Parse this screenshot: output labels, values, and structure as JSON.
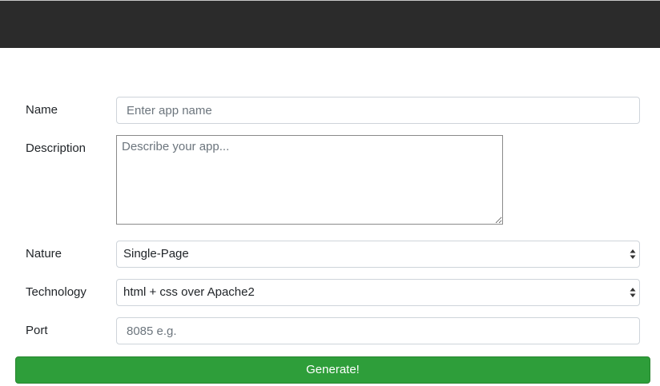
{
  "form": {
    "name": {
      "label": "Name",
      "placeholder": "Enter app name",
      "value": ""
    },
    "description": {
      "label": "Description",
      "placeholder": "Describe your app...",
      "value": ""
    },
    "nature": {
      "label": "Nature",
      "selected": "Single-Page"
    },
    "technology": {
      "label": "Technology",
      "selected": "html + css over Apache2"
    },
    "port": {
      "label": "Port",
      "placeholder": "8085 e.g.",
      "value": ""
    },
    "generate_label": "Generate!"
  },
  "colors": {
    "topbar": "#2b2b2b",
    "generate_button": "#2e9e3a",
    "placeholder_text": "#6c757d"
  }
}
